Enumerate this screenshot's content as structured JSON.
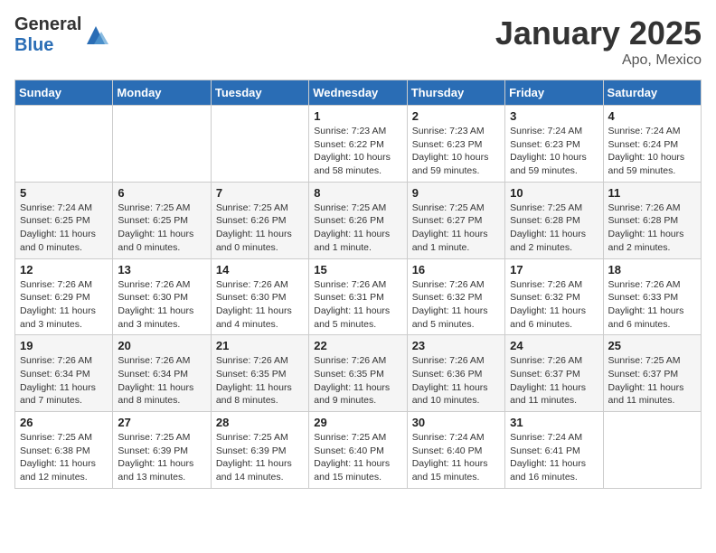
{
  "header": {
    "logo_general": "General",
    "logo_blue": "Blue",
    "month": "January 2025",
    "location": "Apo, Mexico"
  },
  "days_of_week": [
    "Sunday",
    "Monday",
    "Tuesday",
    "Wednesday",
    "Thursday",
    "Friday",
    "Saturday"
  ],
  "weeks": [
    [
      {
        "day": "",
        "sunrise": "",
        "sunset": "",
        "daylight": ""
      },
      {
        "day": "",
        "sunrise": "",
        "sunset": "",
        "daylight": ""
      },
      {
        "day": "",
        "sunrise": "",
        "sunset": "",
        "daylight": ""
      },
      {
        "day": "1",
        "sunrise": "Sunrise: 7:23 AM",
        "sunset": "Sunset: 6:22 PM",
        "daylight": "Daylight: 10 hours and 58 minutes."
      },
      {
        "day": "2",
        "sunrise": "Sunrise: 7:23 AM",
        "sunset": "Sunset: 6:23 PM",
        "daylight": "Daylight: 10 hours and 59 minutes."
      },
      {
        "day": "3",
        "sunrise": "Sunrise: 7:24 AM",
        "sunset": "Sunset: 6:23 PM",
        "daylight": "Daylight: 10 hours and 59 minutes."
      },
      {
        "day": "4",
        "sunrise": "Sunrise: 7:24 AM",
        "sunset": "Sunset: 6:24 PM",
        "daylight": "Daylight: 10 hours and 59 minutes."
      }
    ],
    [
      {
        "day": "5",
        "sunrise": "Sunrise: 7:24 AM",
        "sunset": "Sunset: 6:25 PM",
        "daylight": "Daylight: 11 hours and 0 minutes."
      },
      {
        "day": "6",
        "sunrise": "Sunrise: 7:25 AM",
        "sunset": "Sunset: 6:25 PM",
        "daylight": "Daylight: 11 hours and 0 minutes."
      },
      {
        "day": "7",
        "sunrise": "Sunrise: 7:25 AM",
        "sunset": "Sunset: 6:26 PM",
        "daylight": "Daylight: 11 hours and 0 minutes."
      },
      {
        "day": "8",
        "sunrise": "Sunrise: 7:25 AM",
        "sunset": "Sunset: 6:26 PM",
        "daylight": "Daylight: 11 hours and 1 minute."
      },
      {
        "day": "9",
        "sunrise": "Sunrise: 7:25 AM",
        "sunset": "Sunset: 6:27 PM",
        "daylight": "Daylight: 11 hours and 1 minute."
      },
      {
        "day": "10",
        "sunrise": "Sunrise: 7:25 AM",
        "sunset": "Sunset: 6:28 PM",
        "daylight": "Daylight: 11 hours and 2 minutes."
      },
      {
        "day": "11",
        "sunrise": "Sunrise: 7:26 AM",
        "sunset": "Sunset: 6:28 PM",
        "daylight": "Daylight: 11 hours and 2 minutes."
      }
    ],
    [
      {
        "day": "12",
        "sunrise": "Sunrise: 7:26 AM",
        "sunset": "Sunset: 6:29 PM",
        "daylight": "Daylight: 11 hours and 3 minutes."
      },
      {
        "day": "13",
        "sunrise": "Sunrise: 7:26 AM",
        "sunset": "Sunset: 6:30 PM",
        "daylight": "Daylight: 11 hours and 3 minutes."
      },
      {
        "day": "14",
        "sunrise": "Sunrise: 7:26 AM",
        "sunset": "Sunset: 6:30 PM",
        "daylight": "Daylight: 11 hours and 4 minutes."
      },
      {
        "day": "15",
        "sunrise": "Sunrise: 7:26 AM",
        "sunset": "Sunset: 6:31 PM",
        "daylight": "Daylight: 11 hours and 5 minutes."
      },
      {
        "day": "16",
        "sunrise": "Sunrise: 7:26 AM",
        "sunset": "Sunset: 6:32 PM",
        "daylight": "Daylight: 11 hours and 5 minutes."
      },
      {
        "day": "17",
        "sunrise": "Sunrise: 7:26 AM",
        "sunset": "Sunset: 6:32 PM",
        "daylight": "Daylight: 11 hours and 6 minutes."
      },
      {
        "day": "18",
        "sunrise": "Sunrise: 7:26 AM",
        "sunset": "Sunset: 6:33 PM",
        "daylight": "Daylight: 11 hours and 6 minutes."
      }
    ],
    [
      {
        "day": "19",
        "sunrise": "Sunrise: 7:26 AM",
        "sunset": "Sunset: 6:34 PM",
        "daylight": "Daylight: 11 hours and 7 minutes."
      },
      {
        "day": "20",
        "sunrise": "Sunrise: 7:26 AM",
        "sunset": "Sunset: 6:34 PM",
        "daylight": "Daylight: 11 hours and 8 minutes."
      },
      {
        "day": "21",
        "sunrise": "Sunrise: 7:26 AM",
        "sunset": "Sunset: 6:35 PM",
        "daylight": "Daylight: 11 hours and 8 minutes."
      },
      {
        "day": "22",
        "sunrise": "Sunrise: 7:26 AM",
        "sunset": "Sunset: 6:35 PM",
        "daylight": "Daylight: 11 hours and 9 minutes."
      },
      {
        "day": "23",
        "sunrise": "Sunrise: 7:26 AM",
        "sunset": "Sunset: 6:36 PM",
        "daylight": "Daylight: 11 hours and 10 minutes."
      },
      {
        "day": "24",
        "sunrise": "Sunrise: 7:26 AM",
        "sunset": "Sunset: 6:37 PM",
        "daylight": "Daylight: 11 hours and 11 minutes."
      },
      {
        "day": "25",
        "sunrise": "Sunrise: 7:25 AM",
        "sunset": "Sunset: 6:37 PM",
        "daylight": "Daylight: 11 hours and 11 minutes."
      }
    ],
    [
      {
        "day": "26",
        "sunrise": "Sunrise: 7:25 AM",
        "sunset": "Sunset: 6:38 PM",
        "daylight": "Daylight: 11 hours and 12 minutes."
      },
      {
        "day": "27",
        "sunrise": "Sunrise: 7:25 AM",
        "sunset": "Sunset: 6:39 PM",
        "daylight": "Daylight: 11 hours and 13 minutes."
      },
      {
        "day": "28",
        "sunrise": "Sunrise: 7:25 AM",
        "sunset": "Sunset: 6:39 PM",
        "daylight": "Daylight: 11 hours and 14 minutes."
      },
      {
        "day": "29",
        "sunrise": "Sunrise: 7:25 AM",
        "sunset": "Sunset: 6:40 PM",
        "daylight": "Daylight: 11 hours and 15 minutes."
      },
      {
        "day": "30",
        "sunrise": "Sunrise: 7:24 AM",
        "sunset": "Sunset: 6:40 PM",
        "daylight": "Daylight: 11 hours and 15 minutes."
      },
      {
        "day": "31",
        "sunrise": "Sunrise: 7:24 AM",
        "sunset": "Sunset: 6:41 PM",
        "daylight": "Daylight: 11 hours and 16 minutes."
      },
      {
        "day": "",
        "sunrise": "",
        "sunset": "",
        "daylight": ""
      }
    ]
  ]
}
